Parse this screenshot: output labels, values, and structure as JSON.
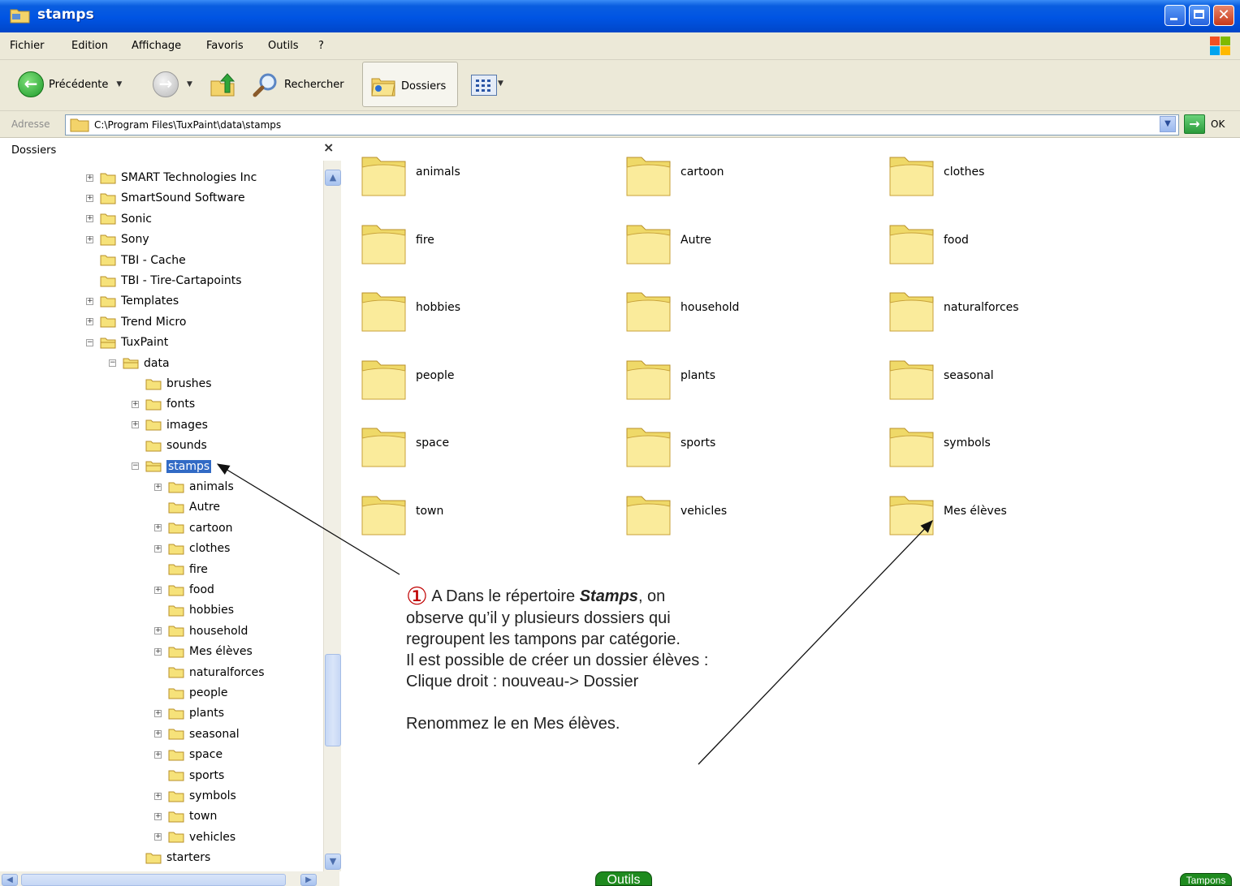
{
  "window": {
    "title": "stamps"
  },
  "menu": [
    "Fichier",
    "Edition",
    "Affichage",
    "Favoris",
    "Outils",
    "?"
  ],
  "toolbar": {
    "back_label": "Précédente",
    "search_label": "Rechercher",
    "folders_label": "Dossiers"
  },
  "address": {
    "label": "Adresse",
    "path": "C:\\Program Files\\TuxPaint\\data\\stamps",
    "go_label": "OK"
  },
  "folders_pane": {
    "title": "Dossiers",
    "close_glyph": "×",
    "tree": [
      {
        "label": "SMART Technologies Inc",
        "level": 0,
        "expander": "+"
      },
      {
        "label": "SmartSound Software",
        "level": 0,
        "expander": "+"
      },
      {
        "label": "Sonic",
        "level": 0,
        "expander": "+"
      },
      {
        "label": "Sony",
        "level": 0,
        "expander": "+"
      },
      {
        "label": "TBI - Cache",
        "level": 0,
        "expander": ""
      },
      {
        "label": "TBI - Tire-Cartapoints",
        "level": 0,
        "expander": ""
      },
      {
        "label": "Templates",
        "level": 0,
        "expander": "+"
      },
      {
        "label": "Trend Micro",
        "level": 0,
        "expander": "+"
      },
      {
        "label": "TuxPaint",
        "level": 0,
        "expander": "−"
      },
      {
        "label": "data",
        "level": 1,
        "expander": "−"
      },
      {
        "label": "brushes",
        "level": 2,
        "expander": ""
      },
      {
        "label": "fonts",
        "level": 2,
        "expander": "+"
      },
      {
        "label": "images",
        "level": 2,
        "expander": "+"
      },
      {
        "label": "sounds",
        "level": 2,
        "expander": ""
      },
      {
        "label": "stamps",
        "level": 2,
        "expander": "−",
        "selected": true
      },
      {
        "label": "animals",
        "level": 3,
        "expander": "+"
      },
      {
        "label": "Autre",
        "level": 3,
        "expander": ""
      },
      {
        "label": "cartoon",
        "level": 3,
        "expander": "+"
      },
      {
        "label": "clothes",
        "level": 3,
        "expander": "+"
      },
      {
        "label": "fire",
        "level": 3,
        "expander": ""
      },
      {
        "label": "food",
        "level": 3,
        "expander": "+"
      },
      {
        "label": "hobbies",
        "level": 3,
        "expander": ""
      },
      {
        "label": "household",
        "level": 3,
        "expander": "+"
      },
      {
        "label": "Mes élèves",
        "level": 3,
        "expander": "+"
      },
      {
        "label": "naturalforces",
        "level": 3,
        "expander": ""
      },
      {
        "label": "people",
        "level": 3,
        "expander": ""
      },
      {
        "label": "plants",
        "level": 3,
        "expander": "+"
      },
      {
        "label": "seasonal",
        "level": 3,
        "expander": "+"
      },
      {
        "label": "space",
        "level": 3,
        "expander": "+"
      },
      {
        "label": "sports",
        "level": 3,
        "expander": ""
      },
      {
        "label": "symbols",
        "level": 3,
        "expander": "+"
      },
      {
        "label": "town",
        "level": 3,
        "expander": "+"
      },
      {
        "label": "vehicles",
        "level": 3,
        "expander": "+"
      },
      {
        "label": "starters",
        "level": 2,
        "expander": ""
      }
    ]
  },
  "content": {
    "folders": [
      "animals",
      "cartoon",
      "clothes",
      "fire",
      "Autre",
      "food",
      "hobbies",
      "household",
      "naturalforces",
      "people",
      "plants",
      "seasonal",
      "space",
      "sports",
      "symbols",
      "town",
      "vehicles",
      "Mes élèves"
    ]
  },
  "annotation": {
    "number_glyph": "①",
    "line1_pre": " A Dans le répertoire ",
    "line1_bold": "Stamps",
    "line1_post": ", on",
    "line2": "observe qu’il y plusieurs dossiers qui",
    "line3": "regroupent les tampons par catégorie.",
    "line4": "Il est possible de créer un dossier élèves :",
    "line5": "Clique droit : nouveau-> Dossier",
    "line6": "Renommez le en Mes élèves."
  },
  "nav_buttons": {
    "outils": "Outils",
    "tampons": "Tampons"
  },
  "colors": {
    "titlebar": "#0054e3",
    "chrome": "#ece9d8",
    "selection": "#316ac5",
    "folder": "#f6e27a",
    "annotation_number": "#c00000",
    "nav_button": "#1e8a1e"
  }
}
